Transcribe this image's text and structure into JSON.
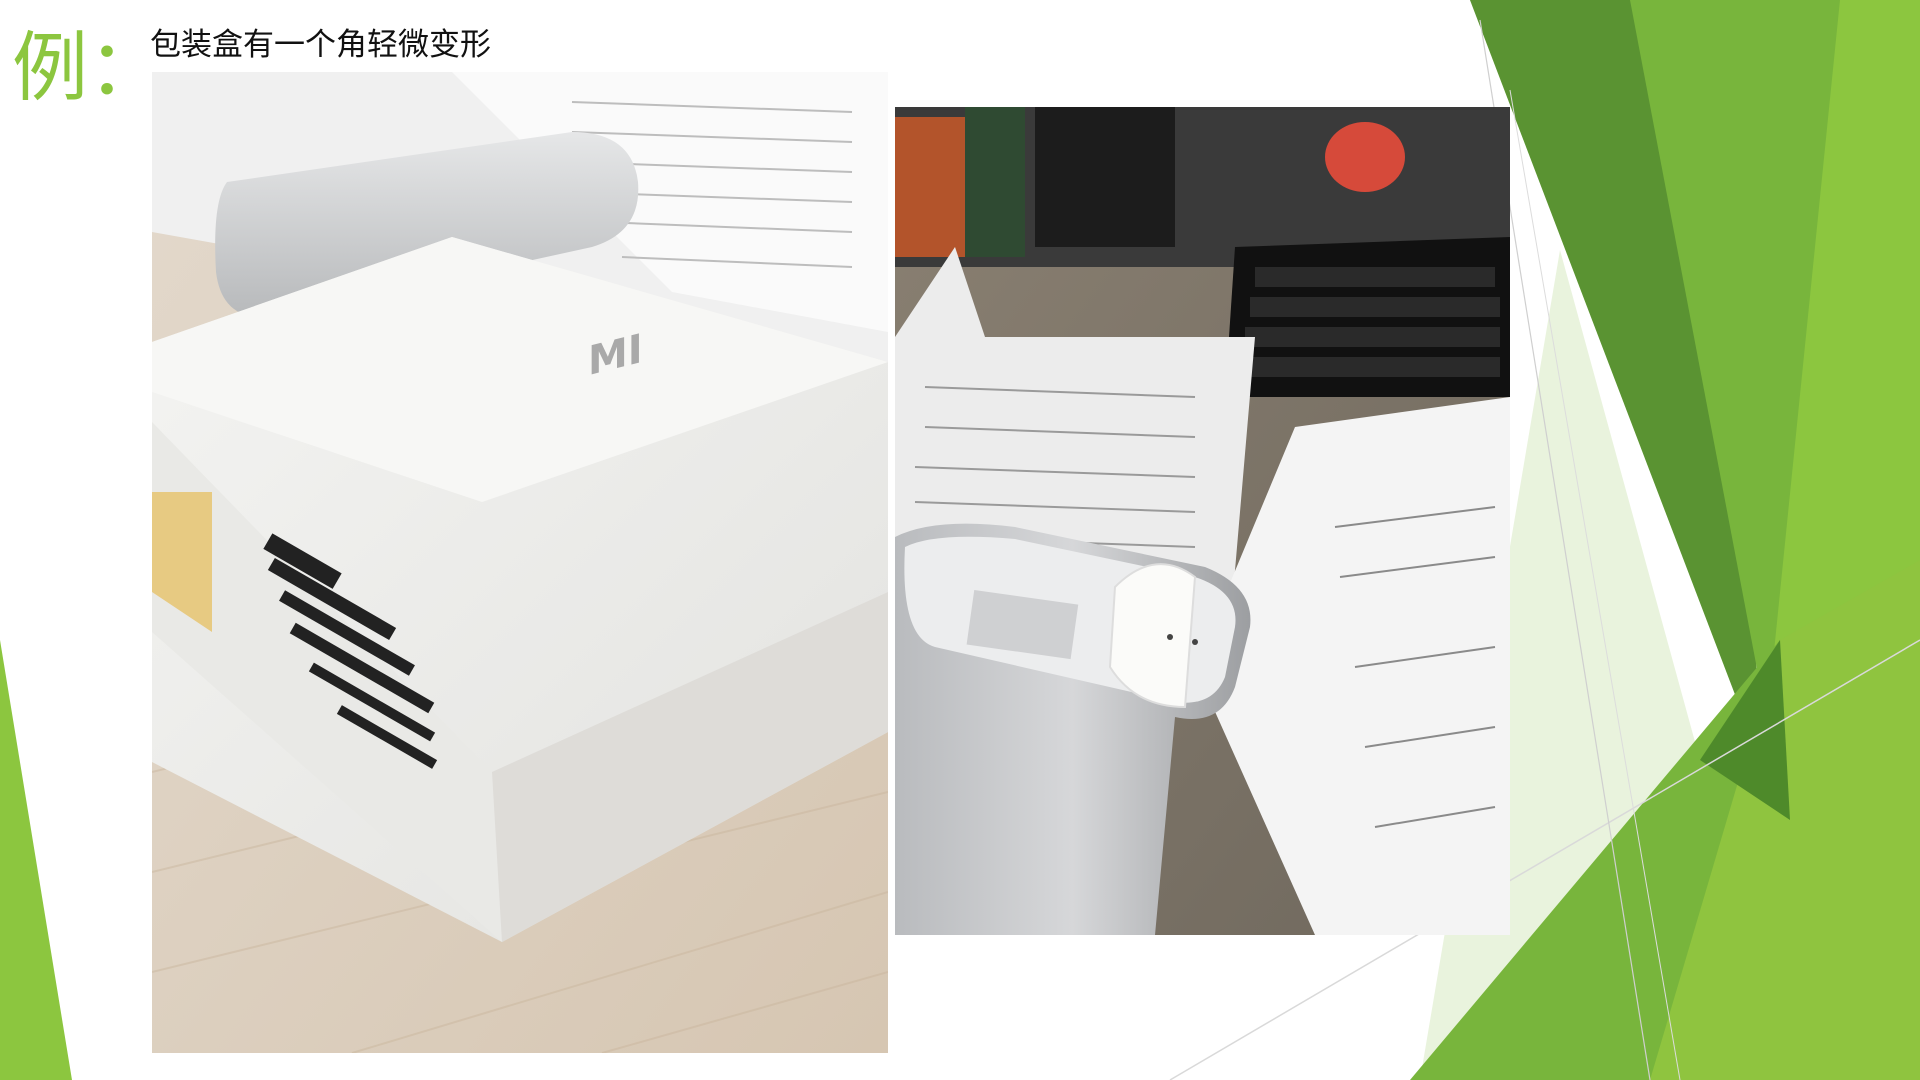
{
  "slide": {
    "title_prefix": "例：",
    "caption": "包装盒有一个角轻微变形"
  },
  "images": {
    "left": {
      "logo_text": "MI"
    }
  },
  "colors": {
    "title_green": "#8cc63f",
    "deco_dark_green": "#4e8a2a",
    "deco_mid_green": "#78b53c",
    "deco_light_green": "#c8e3a4"
  }
}
